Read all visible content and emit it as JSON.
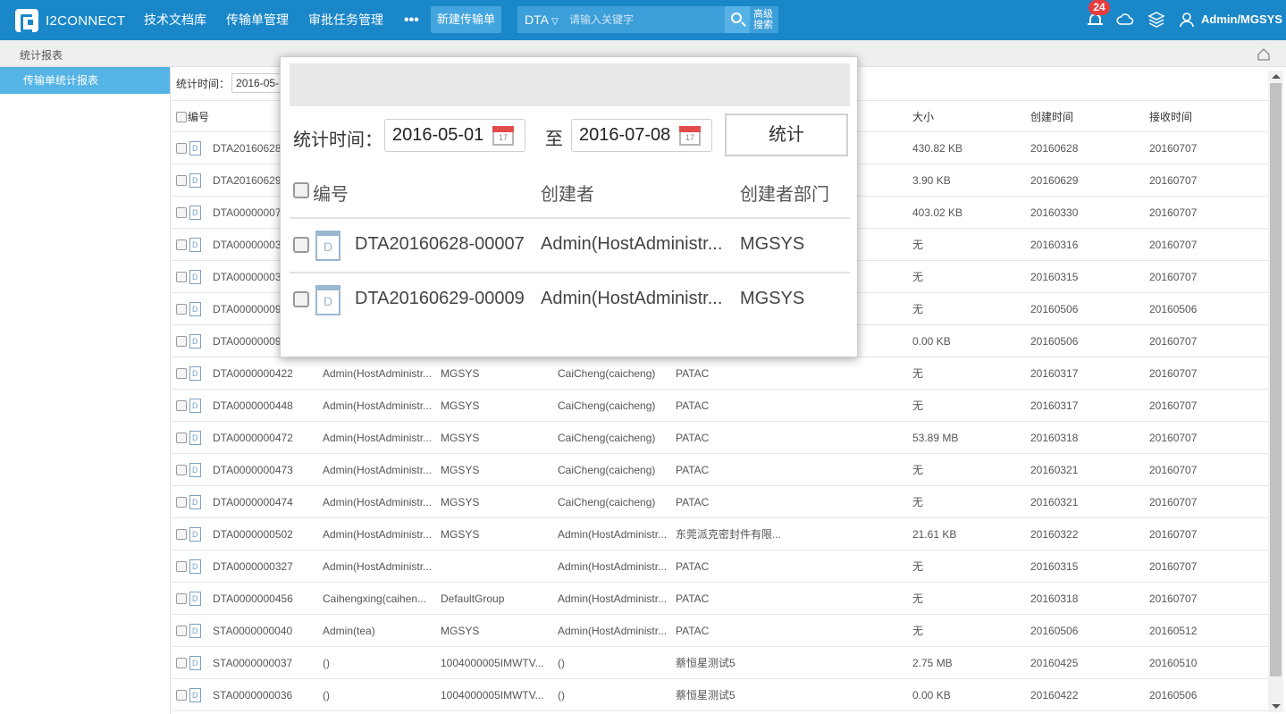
{
  "header": {
    "logo_text": "I2CONNECT",
    "nav": [
      "技术文档库",
      "传输单管理",
      "审批任务管理"
    ],
    "more": "•••",
    "new_button": "新建传输单",
    "search_type": "DTA",
    "search_placeholder": "请输入关键字",
    "advanced_search": "高级搜索",
    "notification_count": "24",
    "user": "Admin/MGSYS"
  },
  "breadcrumb": "统计报表",
  "sidebar": {
    "items": [
      "传输单统计报表"
    ]
  },
  "filter": {
    "label": "统计时间：",
    "start_partial": "2016-05-"
  },
  "table": {
    "headers": {
      "id": "编号",
      "size": "大小",
      "created": "创建时间",
      "received": "接收时间"
    },
    "rows": [
      {
        "id": "DTA20160628",
        "creator": "",
        "dept": "",
        "receiver": "",
        "receiver_dept": "",
        "size": "430.82 KB",
        "created": "20160628",
        "received": "20160707"
      },
      {
        "id": "DTA20160629",
        "creator": "",
        "dept": "",
        "receiver": "",
        "receiver_dept": "",
        "size": "3.90 KB",
        "created": "20160629",
        "received": "20160707"
      },
      {
        "id": "DTA00000007",
        "creator": "",
        "dept": "",
        "receiver": "",
        "receiver_dept": "",
        "size": "403.02 KB",
        "created": "20160330",
        "received": "20160707"
      },
      {
        "id": "DTA00000003",
        "creator": "",
        "dept": "",
        "receiver": "",
        "receiver_dept": "",
        "size": "无",
        "created": "20160316",
        "received": "20160707"
      },
      {
        "id": "DTA00000003",
        "creator": "",
        "dept": "",
        "receiver": "",
        "receiver_dept": "",
        "size": "无",
        "created": "20160315",
        "received": "20160707"
      },
      {
        "id": "DTA00000009",
        "creator": "",
        "dept": "",
        "receiver": "",
        "receiver_dept": "",
        "size": "无",
        "created": "20160506",
        "received": "20160506"
      },
      {
        "id": "DTA00000009",
        "creator": "",
        "dept": "",
        "receiver": "",
        "receiver_dept": "",
        "size": "0.00 KB",
        "created": "20160506",
        "received": "20160707"
      },
      {
        "id": "DTA0000000422",
        "creator": "Admin(HostAdministr...",
        "dept": "MGSYS",
        "receiver": "CaiCheng(caicheng)",
        "receiver_dept": "PATAC",
        "size": "无",
        "created": "20160317",
        "received": "20160707"
      },
      {
        "id": "DTA0000000448",
        "creator": "Admin(HostAdministr...",
        "dept": "MGSYS",
        "receiver": "CaiCheng(caicheng)",
        "receiver_dept": "PATAC",
        "size": "无",
        "created": "20160317",
        "received": "20160707"
      },
      {
        "id": "DTA0000000472",
        "creator": "Admin(HostAdministr...",
        "dept": "MGSYS",
        "receiver": "CaiCheng(caicheng)",
        "receiver_dept": "PATAC",
        "size": "53.89 MB",
        "created": "20160318",
        "received": "20160707"
      },
      {
        "id": "DTA0000000473",
        "creator": "Admin(HostAdministr...",
        "dept": "MGSYS",
        "receiver": "CaiCheng(caicheng)",
        "receiver_dept": "PATAC",
        "size": "无",
        "created": "20160321",
        "received": "20160707"
      },
      {
        "id": "DTA0000000474",
        "creator": "Admin(HostAdministr...",
        "dept": "MGSYS",
        "receiver": "CaiCheng(caicheng)",
        "receiver_dept": "PATAC",
        "size": "无",
        "created": "20160321",
        "received": "20160707"
      },
      {
        "id": "DTA0000000502",
        "creator": "Admin(HostAdministr...",
        "dept": "MGSYS",
        "receiver": "Admin(HostAdministr...",
        "receiver_dept": "东莞派克密封件有限...",
        "size": "21.61 KB",
        "created": "20160322",
        "received": "20160707"
      },
      {
        "id": "DTA0000000327",
        "creator": "Admin(HostAdministr...",
        "dept": "",
        "receiver": "Admin(HostAdministr...",
        "receiver_dept": "PATAC",
        "size": "无",
        "created": "20160315",
        "received": "20160707"
      },
      {
        "id": "DTA0000000456",
        "creator": "Caihengxing(caihen...",
        "dept": "DefaultGroup",
        "receiver": "Admin(HostAdministr...",
        "receiver_dept": "PATAC",
        "size": "无",
        "created": "20160318",
        "received": "20160707"
      },
      {
        "id": "STA0000000040",
        "creator": "Admin(tea)",
        "dept": "MGSYS",
        "receiver": "Admin(HostAdministr...",
        "receiver_dept": "PATAC",
        "size": "无",
        "created": "20160506",
        "received": "20160512"
      },
      {
        "id": "STA0000000037",
        "creator": "()",
        "dept": "1004000005IMWTV...",
        "receiver": "()",
        "receiver_dept": "蔡恒星测试5",
        "size": "2.75 MB",
        "created": "20160425",
        "received": "20160510"
      },
      {
        "id": "STA0000000036",
        "creator": "()",
        "dept": "1004000005IMWTV...",
        "receiver": "()",
        "receiver_dept": "蔡恒星测试5",
        "size": "0.00 KB",
        "created": "20160422",
        "received": "20160506"
      }
    ]
  },
  "popup": {
    "label": "统计时间：",
    "start_date": "2016-05-01",
    "to": "至",
    "end_date": "2016-07-08",
    "button": "统计",
    "headers": {
      "id": "编号",
      "creator": "创建者",
      "dept": "创建者部门"
    },
    "rows": [
      {
        "id": "DTA20160628-00007",
        "creator": "Admin(HostAdministr...",
        "dept": "MGSYS"
      },
      {
        "id": "DTA20160629-00009",
        "creator": "Admin(HostAdministr...",
        "dept": "MGSYS"
      }
    ]
  },
  "colors": {
    "header_bg": "#1a87c9",
    "sidebar_active": "#55b4e6",
    "badge": "#e63c3c"
  }
}
